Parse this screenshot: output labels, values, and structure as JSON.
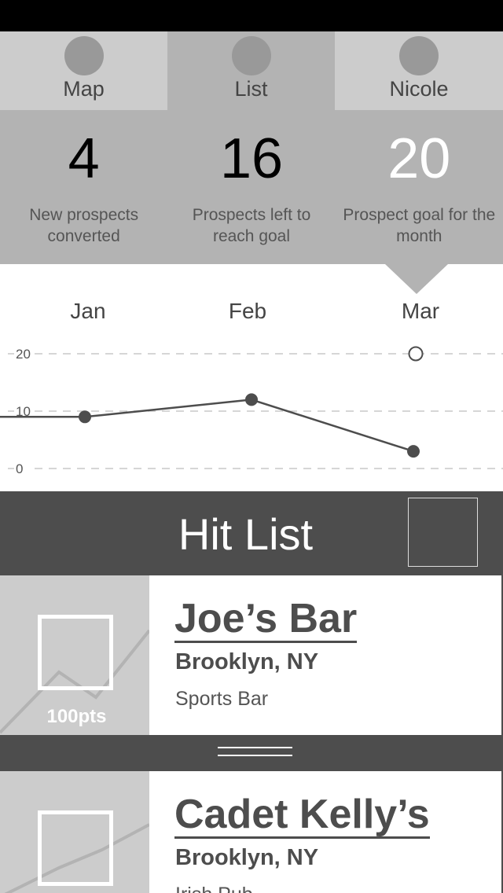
{
  "tabs": [
    {
      "label": "Map",
      "icon": "circle-placeholder-icon",
      "active": false
    },
    {
      "label": "List",
      "icon": "circle-placeholder-icon",
      "active": true
    },
    {
      "label": "Nicole",
      "icon": "circle-placeholder-icon",
      "active": false
    }
  ],
  "stats": [
    {
      "value": "4",
      "label": "New prospects converted"
    },
    {
      "value": "16",
      "label": "Prospects left to reach goal"
    },
    {
      "value": "20",
      "label": "Prospect goal for the month"
    }
  ],
  "chart_data": {
    "type": "line",
    "categories": [
      "Jan",
      "Feb",
      "Mar"
    ],
    "yticks": [
      "20",
      "10",
      "0"
    ],
    "ylim": [
      0,
      20
    ],
    "grid": true,
    "series": [
      {
        "values": [
          9,
          12,
          3
        ]
      }
    ],
    "goal_marker": {
      "category": "Mar",
      "value": 20
    }
  },
  "hitlist": {
    "title": "Hit List"
  },
  "cards": [
    {
      "name": "Joe’s Bar",
      "location": "Brooklyn, NY",
      "type": "Sports Bar",
      "points": "100pts"
    },
    {
      "name": "Cadet Kelly’s",
      "location": "Brooklyn, NY",
      "type": "Irish Pub",
      "points": ""
    }
  ],
  "colors": {
    "dark": "#4d4d4d",
    "mid": "#b3b3b3",
    "light": "#cccccc"
  }
}
